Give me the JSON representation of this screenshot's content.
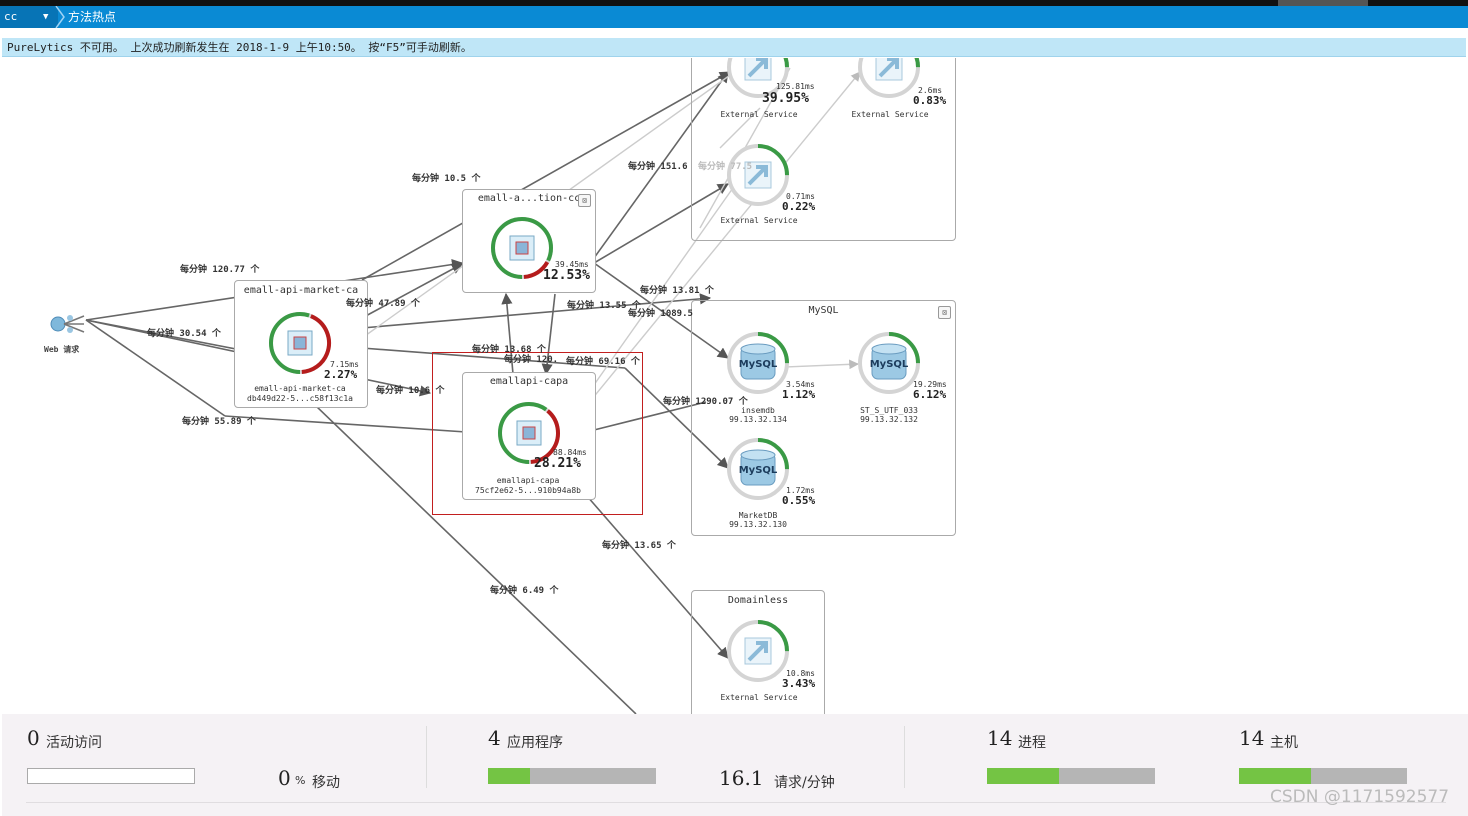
{
  "topbar": {
    "selector_text": "cc",
    "title": "方法热点"
  },
  "notice": {
    "text": "PureLytics 不可用。 上次成功刷新发生在 2018-1-9 上午10:50。 按“F5”可手动刷新。"
  },
  "map": {
    "web_request_label": "Web 请求",
    "groups": [
      {
        "title": ""
      },
      {
        "title": "MySQL"
      },
      {
        "title": "Domainless"
      }
    ],
    "app_boxes": [
      {
        "title": "emall-api-market-ca"
      },
      {
        "title": "emall-a...tion-cc"
      },
      {
        "title": "emallapi-capa"
      }
    ],
    "nodes": [
      {
        "ms": "7.15ms",
        "pct": "2.27%",
        "name": "emall-api-market-ca",
        "sub": "db449d22-5...c58f13c1a",
        "green": 0.55
      },
      {
        "ms": "39.45ms",
        "pct": "12.53%",
        "name": "",
        "sub": "",
        "green": 0.82
      },
      {
        "ms": "88.84ms",
        "pct": "28.21%",
        "name": "emallapi-capa",
        "sub": "75cf2e62-5...910b94a8b",
        "green": 0.6
      },
      {
        "ms": "125.81ms",
        "pct": "39.95%",
        "name": "External Service",
        "sub": "",
        "green": 0.5
      },
      {
        "ms": "2.6ms",
        "pct": "0.83%",
        "name": "External Service",
        "sub": "",
        "green": 0.5
      },
      {
        "ms": "0.71ms",
        "pct": "0.22%",
        "name": "External Service",
        "sub": "",
        "green": 0.5
      },
      {
        "ms": "3.54ms",
        "pct": "1.12%",
        "name": "insemdb",
        "sub": "99.13.32.134",
        "green": 0.5
      },
      {
        "ms": "19.29ms",
        "pct": "6.12%",
        "name": "ST_S_UTF_033",
        "sub": "99.13.32.132",
        "green": 0.5
      },
      {
        "ms": "1.72ms",
        "pct": "0.55%",
        "name": "MarketDB",
        "sub": "99.13.32.130",
        "green": 0.5
      },
      {
        "ms": "10.8ms",
        "pct": "3.43%",
        "name": "External Service",
        "sub": "",
        "green": 0.5
      }
    ],
    "edge_labels": [
      "每分钟 10.5 个",
      "每分钟 120.77 个",
      "每分钟 47.89 个",
      "每分钟 30.54 个",
      "每分钟 55.89 个",
      "每分钟 13.55 个",
      "每分钟 13.68 个",
      "每分钟 120.",
      "每分钟 69.16 个",
      "每分钟 10.6 个",
      "每分钟 151.6",
      "每分钟 77.5",
      "每分钟 13.81 个",
      "每分钟 1089.5",
      "每分钟 1290.07 个",
      "每分钟 13.65 个",
      "每分钟 6.49 个"
    ]
  },
  "footer": {
    "active_visits": {
      "value": "0",
      "label": "活动访问"
    },
    "mobile": {
      "value": "0",
      "unit": "%",
      "label": "移动"
    },
    "apps": {
      "value": "4",
      "label": "应用程序",
      "fill_fraction": 0.25
    },
    "rate": {
      "value": "16.1",
      "label": "请求/分钟"
    },
    "processes": {
      "value": "14",
      "label": "进程",
      "fill_fraction": 0.43
    },
    "hosts": {
      "value": "14",
      "label": "主机",
      "fill_fraction": 0.43
    }
  },
  "watermark": "CSDN @1171592577"
}
